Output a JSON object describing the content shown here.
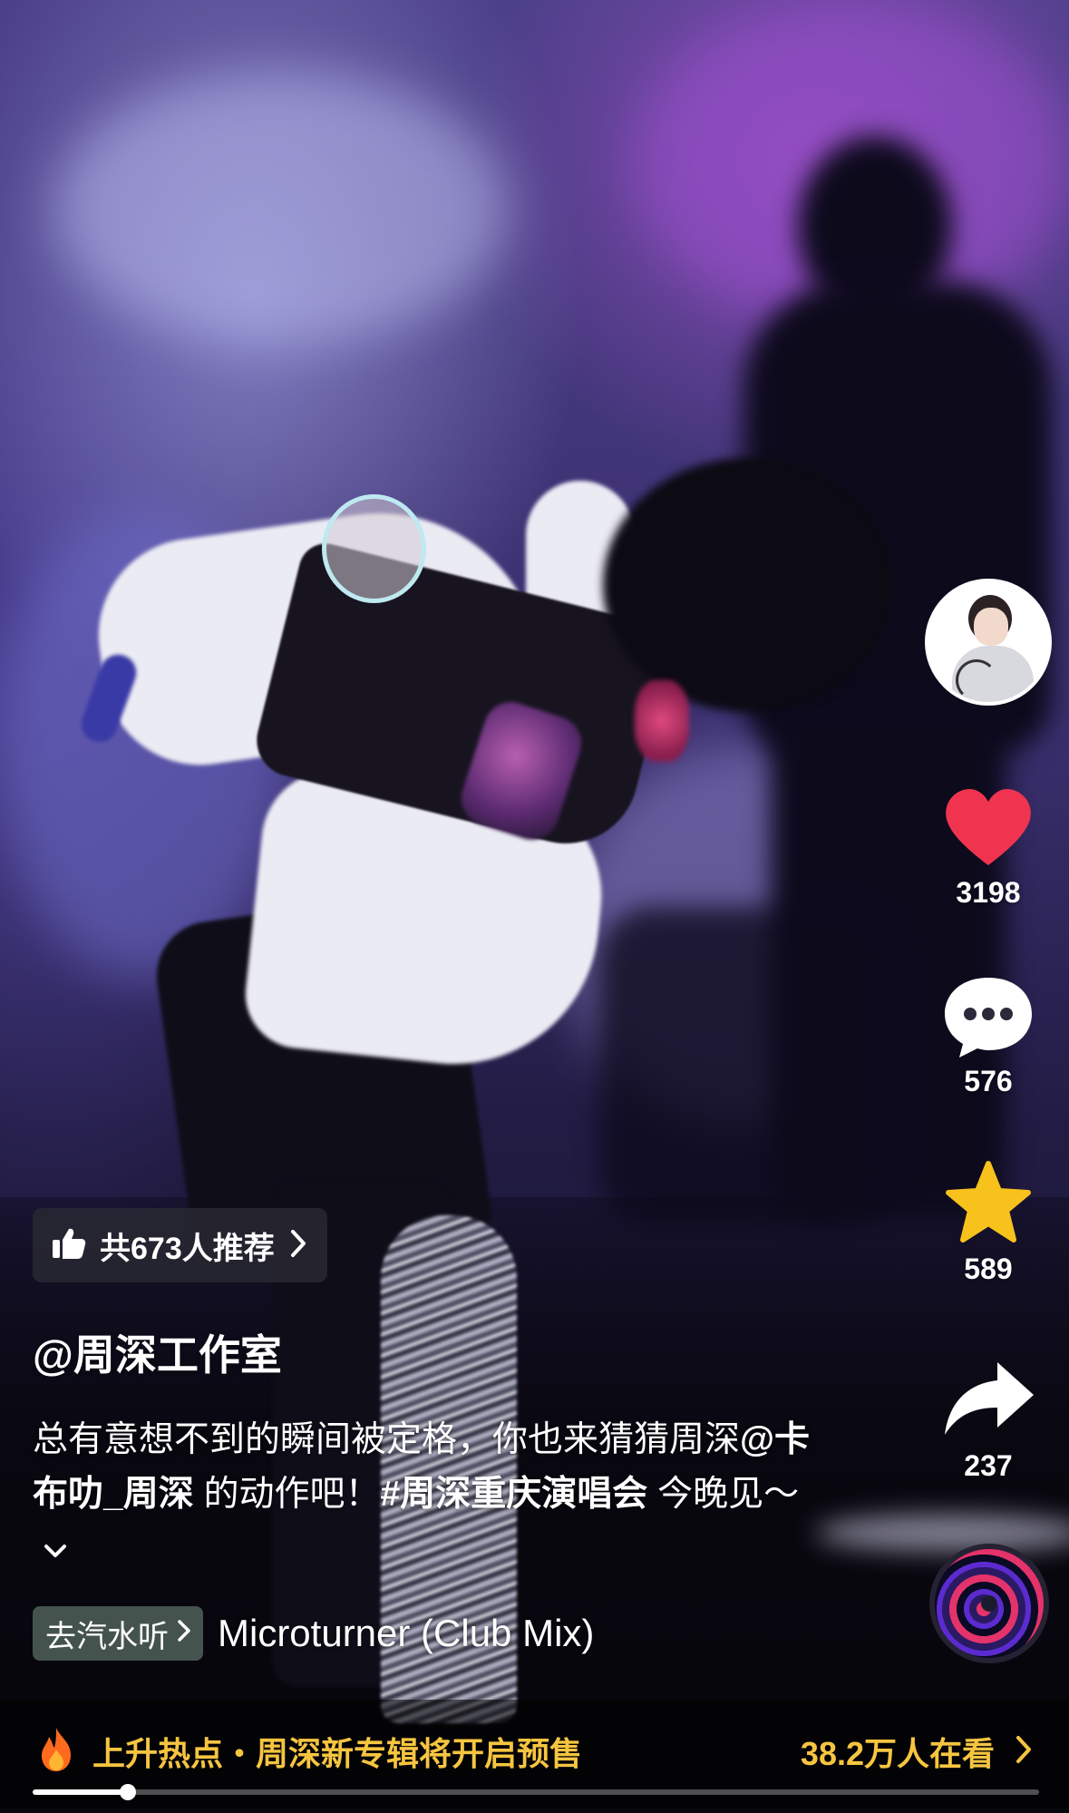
{
  "sidebar": {
    "avatar_icon": "creator-avatar",
    "like": {
      "icon": "heart-icon",
      "count": "3198",
      "color": "#f0344f"
    },
    "comment": {
      "icon": "comment-bubble-icon",
      "count": "576"
    },
    "favorite": {
      "icon": "star-icon",
      "count": "589",
      "color": "#f8c21c"
    },
    "share": {
      "icon": "share-arrow-icon",
      "count": "237"
    },
    "music_disc_icon": "music-disc"
  },
  "recommend": {
    "icon": "thumbs-up-icon",
    "label": "共673人推荐"
  },
  "post": {
    "username": "@周深工作室",
    "caption_part1": "总有意想不到的瞬间被定格，你也来猜猜周深",
    "caption_mention": "@卡布叻_周深",
    "caption_part2": " 的动作吧！",
    "caption_tag": "#周深重庆演唱会",
    "caption_part3": " 今晚见～"
  },
  "music": {
    "button_label": "去汽水听",
    "title": "Microturner (Club Mix)"
  },
  "hotbar": {
    "icon": "fire-icon",
    "text": "上升热点・周深新专辑将开启预售",
    "viewers": "38.2万人在看",
    "accent": "#f6c540"
  },
  "progress": {
    "value": 0.095
  }
}
